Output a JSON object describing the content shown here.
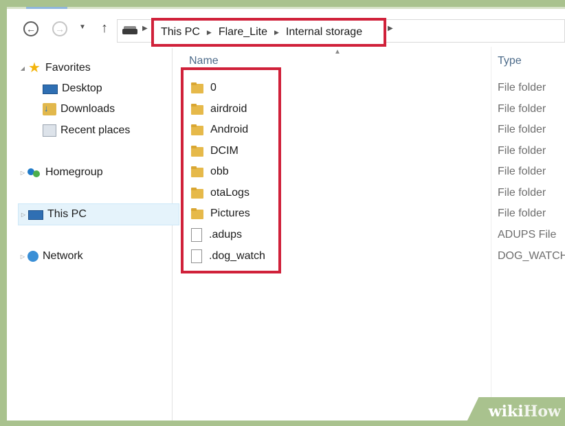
{
  "breadcrumb": [
    "This PC",
    "Flare_Lite",
    "Internal storage"
  ],
  "sidebar": {
    "favorites": "Favorites",
    "desktop": "Desktop",
    "downloads": "Downloads",
    "recent_places": "Recent places",
    "homegroup": "Homegroup",
    "this_pc": "This PC",
    "network": "Network"
  },
  "columns": {
    "name": "Name",
    "type": "Type"
  },
  "files": [
    {
      "name": "0",
      "type": "File folder",
      "icon": "folder-icon"
    },
    {
      "name": "airdroid",
      "type": "File folder",
      "icon": "folder-icon"
    },
    {
      "name": "Android",
      "type": "File folder",
      "icon": "folder-icon"
    },
    {
      "name": "DCIM",
      "type": "File folder",
      "icon": "folder-icon"
    },
    {
      "name": "obb",
      "type": "File folder",
      "icon": "folder-icon"
    },
    {
      "name": "otaLogs",
      "type": "File folder",
      "icon": "folder-icon"
    },
    {
      "name": "Pictures",
      "type": "File folder",
      "icon": "folder-icon"
    },
    {
      "name": ".adups",
      "type": "ADUPS File",
      "icon": "file-icon"
    },
    {
      "name": ".dog_watch",
      "type": "DOG_WATCH",
      "icon": "file-icon"
    }
  ],
  "watermark": {
    "wiki": "wiki",
    "how": "How"
  },
  "colors": {
    "highlight": "#d0213a",
    "selected_bg": "#e5f3fb",
    "folder": "#e6b94a"
  }
}
